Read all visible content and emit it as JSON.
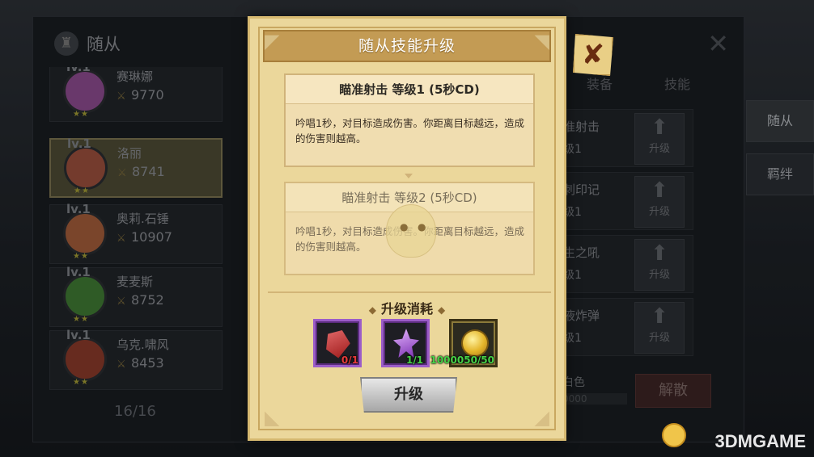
{
  "background": {
    "title": "随从",
    "close_glyph": "✕",
    "heroes": [
      {
        "level": "lv.1",
        "name": "赛琳娜",
        "power": "9770",
        "stars": "★★",
        "avatar_color": "#8d4b8f",
        "selected": false
      },
      {
        "level": "lv.1",
        "name": "洛丽",
        "power": "8741",
        "stars": "★★",
        "avatar_color": "#9b4f3c",
        "selected": true
      },
      {
        "level": "lv.1",
        "name": "奥莉.石锤",
        "power": "10907",
        "stars": "★★",
        "avatar_color": "#a35d3a",
        "selected": false
      },
      {
        "level": "lv.1",
        "name": "麦麦斯",
        "power": "8752",
        "stars": "★★",
        "avatar_color": "#3f7a33",
        "selected": false
      },
      {
        "level": "lv.1",
        "name": "乌克.啸风",
        "power": "8453",
        "stars": "★★",
        "avatar_color": "#8a3a2a",
        "selected": false
      }
    ],
    "hero_count": "16/16",
    "tabs": [
      "装备",
      "技能"
    ],
    "skills": [
      {
        "name": "准射击",
        "level": "级1",
        "upgrade": "升级"
      },
      {
        "name": "刺印记",
        "level": "级1",
        "upgrade": "升级"
      },
      {
        "name": "生之吼",
        "level": "级1",
        "upgrade": "升级"
      },
      {
        "name": "液炸弹",
        "level": "级1",
        "upgrade": "升级"
      }
    ],
    "quality": "白色",
    "exp_value": "0000",
    "disband_label": "解散",
    "side_tabs": [
      "随从",
      "羁绊"
    ]
  },
  "modal": {
    "title": "随从技能升级",
    "current_skill": {
      "header": "瞄准射击   等级1   (5秒CD)",
      "description": "吟唱1秒，对目标造成伤害。你距离目标越远，造成的伤害则越高。"
    },
    "next_skill": {
      "header": "瞄准射击   等级2   (5秒CD)",
      "description": "吟唱1秒，对目标造成伤害。你距离目标越远，造成的伤害则越高。"
    },
    "cost_title": "升级消耗",
    "costs": [
      {
        "item": "red-gem",
        "count": "0/1",
        "status": "insufficient"
      },
      {
        "item": "purple-crystal",
        "count": "1/1",
        "status": "sufficient"
      },
      {
        "item": "gold-coin",
        "count": "1000050/50",
        "status": "sufficient"
      }
    ],
    "upgrade_label": "升级",
    "close_glyph": "✘"
  },
  "watermark": "3DMGAME",
  "colors": {
    "parchment": "#ebd79b",
    "title_band": "#c39b54",
    "insufficient": "#e53a3a",
    "sufficient": "#46d146"
  }
}
